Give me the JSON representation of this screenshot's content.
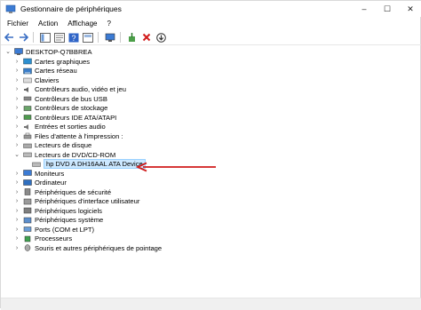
{
  "window": {
    "title": "Gestionnaire de périphériques",
    "minimize": "–",
    "maximize": "☐",
    "close": "✕"
  },
  "menu": [
    "Fichier",
    "Action",
    "Affichage",
    "?"
  ],
  "tree": {
    "root": "DESKTOP-Q7BBREA",
    "items": [
      "Cartes graphiques",
      "Cartes réseau",
      "Claviers",
      "Contrôleurs audio, vidéo et jeu",
      "Contrôleurs de bus USB",
      "Contrôleurs de stockage",
      "Contrôleurs IDE ATA/ATAPI",
      "Entrées et sorties audio",
      "Files d'attente à l'impression :",
      "Lecteurs de disque",
      "Lecteurs de DVD/CD-ROM",
      "hp DVD A  DH16AAL ATA Device",
      "Moniteurs",
      "Ordinateur",
      "Périphériques de sécurité",
      "Périphériques d'interface utilisateur",
      "Périphériques logiciels",
      "Périphériques système",
      "Ports (COM et LPT)",
      "Processeurs",
      "Souris et autres périphériques de pointage"
    ]
  },
  "colors": {
    "selection": "#cce8ff",
    "annotation_arrow": "#d01c1c"
  }
}
